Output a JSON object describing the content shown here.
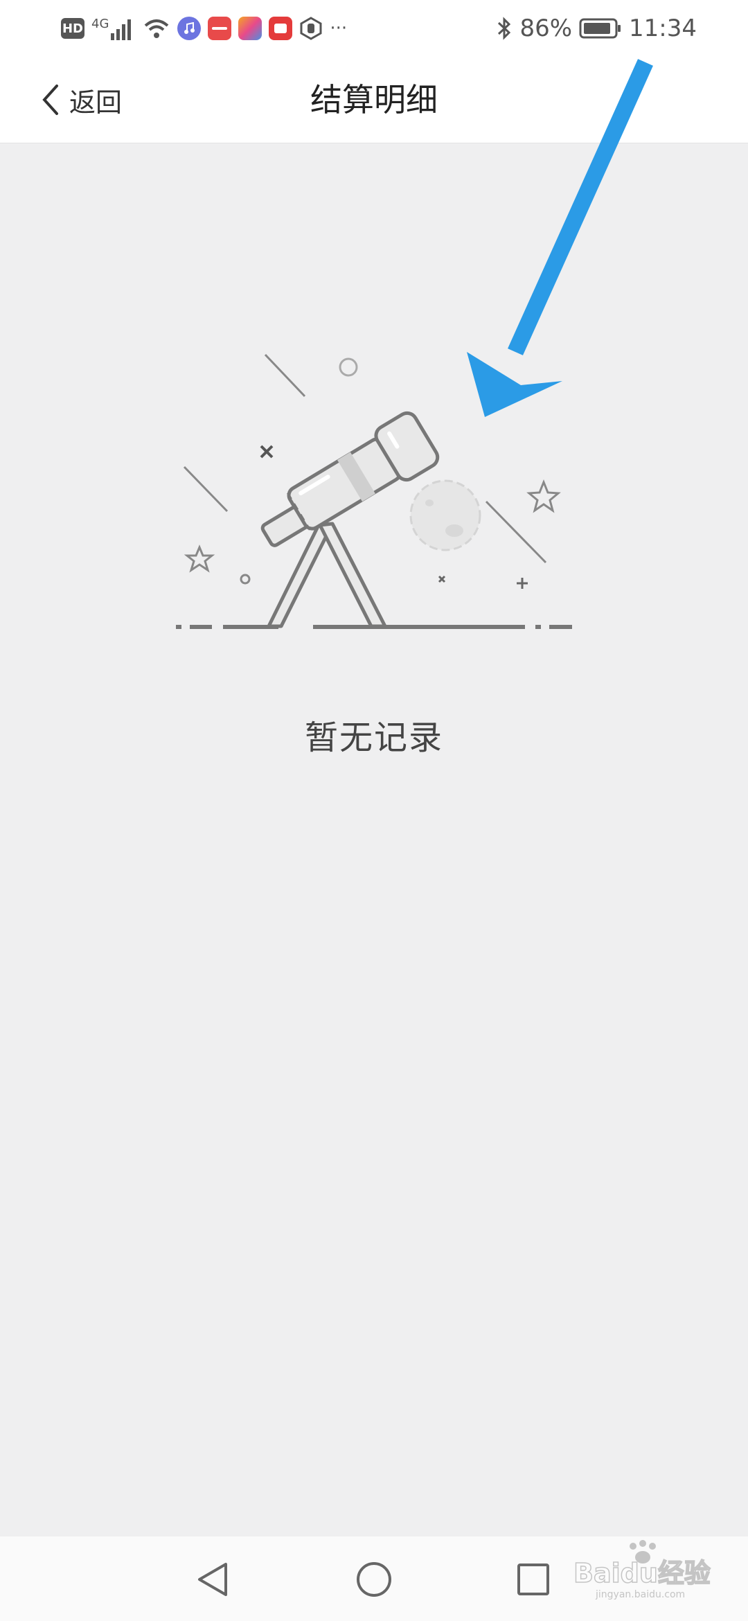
{
  "status_bar": {
    "hd": "HD",
    "network": "4G",
    "battery": "86%",
    "time": "11:34",
    "more": "···",
    "icons": [
      "hd-icon",
      "signal-icon",
      "wifi-icon",
      "music-app-icon",
      "huawei-app-icon",
      "gallery-app-icon",
      "red-app-icon",
      "hand-icon",
      "bluetooth-icon",
      "battery-icon"
    ]
  },
  "header": {
    "back_label": "返回",
    "title": "结算明细"
  },
  "empty_state": {
    "message": "暂无记录",
    "illustration": "telescope-illustration"
  },
  "nav_bar": {
    "buttons": [
      "back-triangle-icon",
      "home-circle-icon",
      "recents-square-icon"
    ]
  },
  "watermark": {
    "text": "Baidu经验",
    "sub": "jingyan.baidu.com"
  },
  "colors": {
    "arrow": "#2b9be6",
    "background": "#efeff0",
    "header_bg": "#ffffff"
  }
}
